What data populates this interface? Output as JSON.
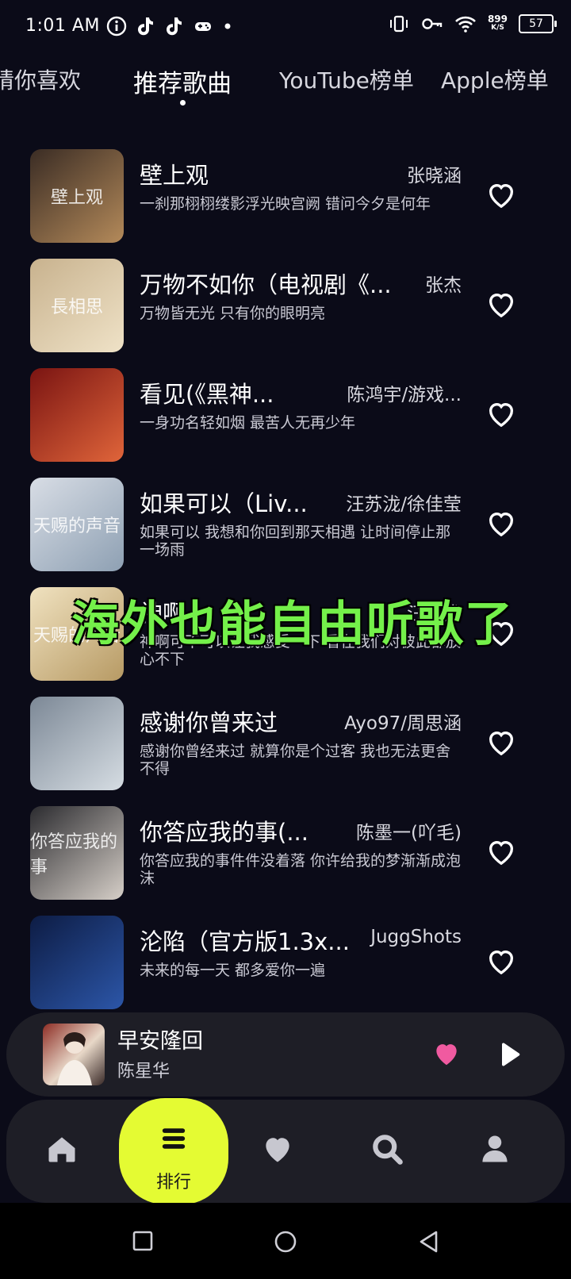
{
  "status_bar": {
    "time": "1:01 AM",
    "left_icons": [
      "info-icon",
      "tiktok-icon",
      "tiktok-icon",
      "gamepad-icon",
      "dot"
    ],
    "speed_value": "899",
    "speed_unit": "K/S",
    "battery": "57"
  },
  "tabs": [
    {
      "label": "猜你喜欢"
    },
    {
      "label": "推荐歌曲",
      "active": true
    },
    {
      "label": "YouTube榜单"
    },
    {
      "label": "Apple榜单"
    }
  ],
  "songs": [
    {
      "title": "壁上观",
      "artist": "张晓涵",
      "lyric": "一刹那栩栩缕影浮光映宫阙 错问今夕是何年",
      "cover_text": "壁上观",
      "cover_colors": [
        "#3a2c24",
        "#b48a5a"
      ]
    },
    {
      "title": "万物不如你（电视剧《...",
      "artist": "张杰",
      "lyric": "万物皆无光 只有你的眼明亮",
      "cover_text": "長相思",
      "cover_colors": [
        "#c8b28e",
        "#efe2c7"
      ]
    },
    {
      "title": "看见(《黑神...",
      "artist": "陈鸿宇/游戏...",
      "lyric": "一身功名轻如烟 最苦人无再少年",
      "cover_text": "",
      "cover_colors": [
        "#7a1412",
        "#e0653a"
      ]
    },
    {
      "title": "如果可以（Liv...",
      "artist": "汪苏泷/徐佳莹",
      "lyric": "如果可以 我想和你回到那天相遇 让时间停止那一场雨",
      "cover_text": "天赐的声音",
      "cover_colors": [
        "#d8dde5",
        "#8ea0b3"
      ]
    },
    {
      "title": "神啊",
      "artist": "汪苏泷",
      "lyric": "神啊可不可以让我感受一下 看在我们对彼此都放心不下",
      "cover_text": "天赐的声音",
      "cover_colors": [
        "#f0e2c0",
        "#b79a64"
      ]
    },
    {
      "title": "感谢你曾来过",
      "artist": "Ayo97/周思涵",
      "lyric": "感谢你曾经来过 就算你是个过客 我也无法更舍不得",
      "cover_text": "",
      "cover_colors": [
        "#7c8896",
        "#d6dde3"
      ]
    },
    {
      "title": "你答应我的事(...",
      "artist": "陈墨一(吖毛)",
      "lyric": "你答应我的事件件没着落 你许给我的梦渐渐成泡沫",
      "cover_text": "你答应我的事",
      "cover_colors": [
        "#2b2b2f",
        "#d6cfc8"
      ]
    },
    {
      "title": "沦陷（官方版1.3x...",
      "artist": "JuggShots",
      "lyric": "未来的每一天 都多爱你一遍",
      "cover_text": "",
      "cover_colors": [
        "#0d1c44",
        "#2c56a8"
      ]
    }
  ],
  "overlay_caption": "海外也能自由听歌了",
  "now_playing": {
    "title": "早安隆回",
    "artist": "陈星华",
    "liked": true,
    "heart_color": "#f05aa0"
  },
  "bottom_nav": {
    "items": [
      "home-icon",
      "ranking-icon",
      "heart-icon",
      "search-icon",
      "profile-icon"
    ],
    "active_label": "排行",
    "active_color": "#e4fb33"
  }
}
